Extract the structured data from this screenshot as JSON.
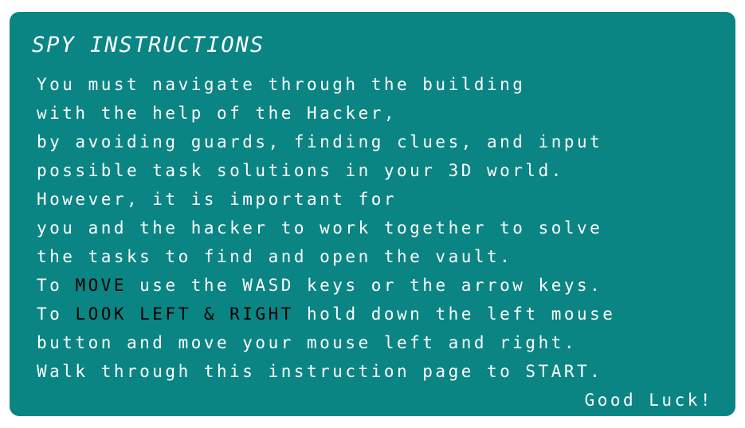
{
  "title": "SPY INSTRUCTIONS",
  "lines": {
    "l1": "You must navigate through the building",
    "l2": "with the help of the Hacker,",
    "l3": "by avoiding guards, finding clues, and input",
    "l4": "possible task solutions in your 3D world.",
    "l5": "However, it is important for",
    "l6": "you and the hacker to work together to solve",
    "l7": "the tasks to find and open the vault.",
    "l8": {
      "prefix": "To ",
      "highlight": "MOVE",
      "suffix": " use the WASD keys or the arrow keys."
    },
    "l9": {
      "prefix": "To ",
      "highlight": "LOOK LEFT & RIGHT",
      "suffix": " hold down the left mouse"
    },
    "l10": "button and move your mouse left and right.",
    "l11": "Walk through this instruction page to START."
  },
  "signoff": "Good Luck!",
  "colors": {
    "panel": "#0b8583",
    "text": "#ffffff",
    "highlight": "#000000"
  }
}
